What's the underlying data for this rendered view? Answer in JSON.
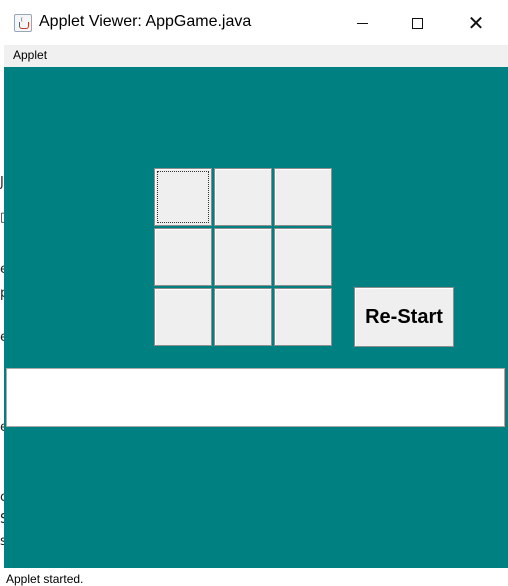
{
  "window": {
    "title": "Applet Viewer: AppGame.java",
    "icon": "java-coffee-icon",
    "controls": [
      "minimize-icon",
      "maximize-icon",
      "close-icon"
    ]
  },
  "menu": {
    "items": [
      "Applet"
    ]
  },
  "game": {
    "board": [
      [
        "",
        "",
        ""
      ],
      [
        "",
        "",
        ""
      ],
      [
        "",
        "",
        ""
      ]
    ],
    "restart_label": "Re-Start",
    "message": ""
  },
  "status": {
    "text": "Applet started."
  },
  "colors": {
    "background": "#008080",
    "cell": "#efefef",
    "field": "#ffffff"
  }
}
